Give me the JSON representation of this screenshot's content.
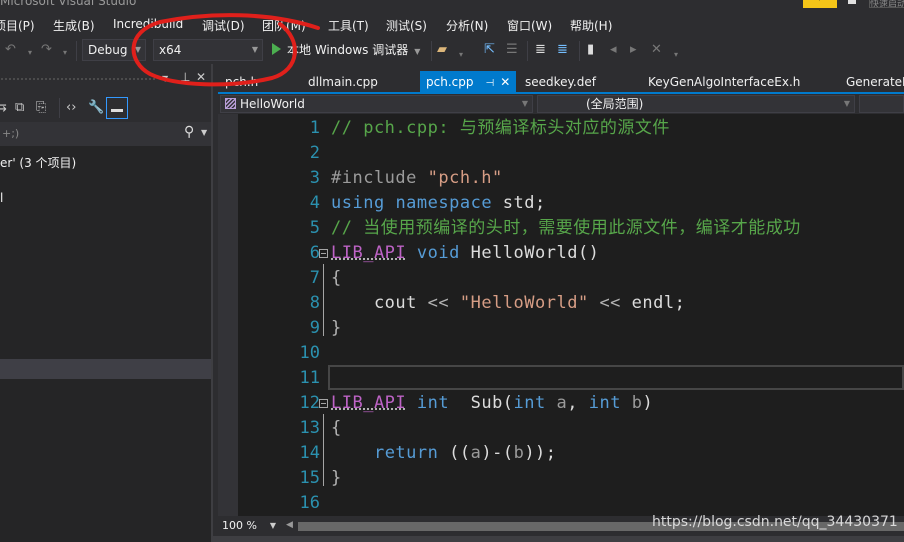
{
  "window": {
    "title": "Microsoft Visual Studio",
    "quick_launch_placeholder": "快速启动"
  },
  "menu": {
    "items": [
      "项目(P)",
      "生成(B)",
      "Incredibuild",
      "调试(D)",
      "团队(M)",
      "工具(T)",
      "测试(S)",
      "分析(N)",
      "窗口(W)",
      "帮助(H)"
    ]
  },
  "toolbar": {
    "undo_icon": "undo-icon",
    "redo_icon": "redo-icon",
    "configuration": "Debug",
    "platform": "x64",
    "run_label": "本地 Windows 调试器"
  },
  "solution_explorer": {
    "search_placeholder": "+;)",
    "tree": [
      "er' (3 个项目)",
      "l"
    ]
  },
  "tabs": [
    {
      "label": "pch.h",
      "active": false
    },
    {
      "label": "dllmain.cpp",
      "active": false
    },
    {
      "label": "pch.cpp",
      "active": true
    },
    {
      "label": "seedkey.def",
      "active": false
    },
    {
      "label": "KeyGenAlgoInterfaceEx.h",
      "active": false
    },
    {
      "label": "GenerateK",
      "active": false
    }
  ],
  "navbar": {
    "scope": "HelloWorld",
    "members": "(全局范围)"
  },
  "editor": {
    "lines": [
      {
        "n": "1",
        "tokens": [
          {
            "t": "// pch.cpp: 与预编译标头对应的源文件",
            "c": "c-comment"
          }
        ]
      },
      {
        "n": "2",
        "tokens": []
      },
      {
        "n": "3",
        "tokens": [
          {
            "t": "#include ",
            "c": "c-pre"
          },
          {
            "t": "\"pch.h\"",
            "c": "c-str"
          }
        ]
      },
      {
        "n": "4",
        "tokens": [
          {
            "t": "using",
            "c": "c-kw"
          },
          {
            "t": " "
          },
          {
            "t": "namespace",
            "c": "c-kw"
          },
          {
            "t": " std;"
          }
        ]
      },
      {
        "n": "5",
        "tokens": [
          {
            "t": "// 当使用预编译的头时，需要使用此源文件，编译才能成功",
            "c": "c-comment"
          }
        ]
      },
      {
        "n": "6",
        "fold": true,
        "tokens": [
          {
            "t": "LIB_API",
            "c": "c-macro"
          },
          {
            "t": " "
          },
          {
            "t": "void",
            "c": "c-kw"
          },
          {
            "t": " HelloWorld()"
          }
        ]
      },
      {
        "n": "7",
        "tokens": [
          {
            "t": "{",
            "c": "c-op"
          }
        ]
      },
      {
        "n": "8",
        "tokens": [
          {
            "t": "    cout "
          },
          {
            "t": "<<",
            "c": "c-op"
          },
          {
            "t": " "
          },
          {
            "t": "\"HelloWorld\"",
            "c": "c-str"
          },
          {
            "t": " "
          },
          {
            "t": "<<",
            "c": "c-op"
          },
          {
            "t": " endl;"
          }
        ]
      },
      {
        "n": "9",
        "tokens": [
          {
            "t": "}",
            "c": "c-op"
          }
        ]
      },
      {
        "n": "10",
        "tokens": []
      },
      {
        "n": "11",
        "tokens": []
      },
      {
        "n": "12",
        "fold": true,
        "tokens": [
          {
            "t": "LIB_API",
            "c": "c-macro"
          },
          {
            "t": " "
          },
          {
            "t": "int",
            "c": "c-kw"
          },
          {
            "t": "  Sub("
          },
          {
            "t": "int",
            "c": "c-kw"
          },
          {
            "t": " "
          },
          {
            "t": "a",
            "c": "c-param"
          },
          {
            "t": ", "
          },
          {
            "t": "int",
            "c": "c-kw"
          },
          {
            "t": " "
          },
          {
            "t": "b",
            "c": "c-param"
          },
          {
            "t": ")"
          }
        ]
      },
      {
        "n": "13",
        "tokens": [
          {
            "t": "{",
            "c": "c-op"
          }
        ]
      },
      {
        "n": "14",
        "tokens": [
          {
            "t": "    "
          },
          {
            "t": "return",
            "c": "c-kw"
          },
          {
            "t": " (("
          },
          {
            "t": "a",
            "c": "c-param"
          },
          {
            "t": ")-("
          },
          {
            "t": "b",
            "c": "c-param"
          },
          {
            "t": "));"
          }
        ]
      },
      {
        "n": "15",
        "tokens": [
          {
            "t": "}",
            "c": "c-op"
          }
        ]
      },
      {
        "n": "16",
        "tokens": []
      }
    ]
  },
  "bottom": {
    "zoom": "100 %"
  },
  "watermark": "https://blog.csdn.net/qq_34430371",
  "colors": {
    "accent": "#007acc",
    "annotation": "#e0201b"
  }
}
